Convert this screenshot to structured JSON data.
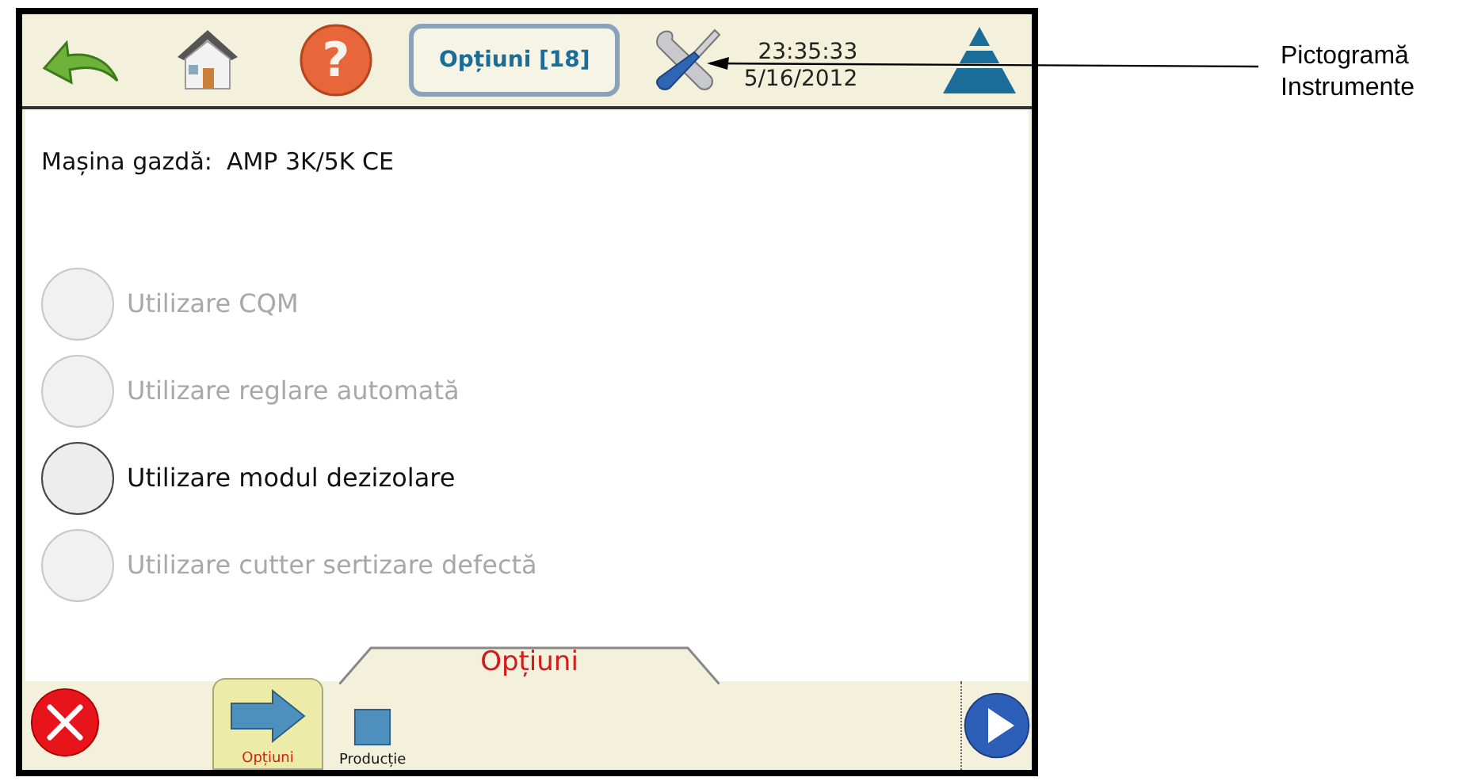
{
  "header": {
    "title": "Opțiuni [18]",
    "help_glyph": "?",
    "time": "23:35:33",
    "date": "5/16/2012"
  },
  "host": {
    "label": "Mașina gazdă:",
    "value": "AMP 3K/5K CE"
  },
  "options": [
    {
      "label": "Utilizare CQM",
      "disabled": true
    },
    {
      "label": "Utilizare reglare automată",
      "disabled": true
    },
    {
      "label": "Utilizare modul dezizolare",
      "disabled": false
    },
    {
      "label": "Utilizare cutter sertizare defectă",
      "disabled": true
    }
  ],
  "panel_tab": "Opțiuni",
  "nav_tabs": [
    {
      "label": "Opțiuni",
      "kind": "arrow",
      "selected": true
    },
    {
      "label": "Producție",
      "kind": "square",
      "selected": false
    }
  ],
  "callout": {
    "lines": [
      "Pictogramă",
      "Instrumente"
    ]
  }
}
